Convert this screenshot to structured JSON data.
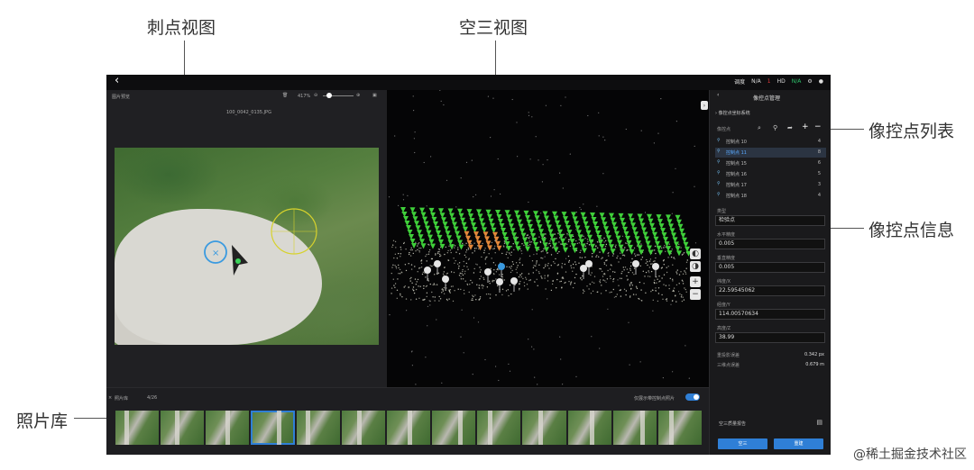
{
  "callouts": {
    "ci_dian": "刺点视图",
    "kong_san": "空三视图",
    "list": "像控点列表",
    "info": "像控点信息",
    "photo_lib": "照片库"
  },
  "topbar": {
    "back_icon": "chevron-left",
    "status": [
      "调度",
      "N/A",
      "1",
      "HD",
      "N/A"
    ]
  },
  "left_panel": {
    "title": "图片预览",
    "zoom": "417%",
    "filename": "100_0042_0135.JPG"
  },
  "right_panel": {
    "title": "像控点管理",
    "section": "像控点坐标系统",
    "list_header": "像控点",
    "points": [
      {
        "name": "控制点 10",
        "count": "4"
      },
      {
        "name": "控制点 11",
        "count": "8",
        "selected": true
      },
      {
        "name": "控制点 15",
        "count": "6"
      },
      {
        "name": "控制点 16",
        "count": "5"
      },
      {
        "name": "控制点 17",
        "count": "3"
      },
      {
        "name": "控制点 18",
        "count": "4"
      }
    ],
    "type_label": "类型",
    "type_value": "检验点",
    "h_acc_label": "水平精度",
    "h_acc": "0.005",
    "v_acc_label": "垂直精度",
    "v_acc": "0.005",
    "lat_label": "纬度/X",
    "lat": "22.59545062",
    "lon_label": "经度/Y",
    "lon": "114.00570634",
    "alt_label": "高度/Z",
    "alt": "38.99",
    "reproj_label": "重投影误差",
    "reproj": "0.342 px",
    "err3d_label": "三维点误差",
    "err3d": "0.679 m",
    "report": "空三质量报告",
    "btn_left": "空三",
    "btn_right": "重建"
  },
  "strip": {
    "label": "照片库",
    "count": "4/26",
    "toggle_label": "仅展示带控制点照片"
  },
  "watermark": "@稀土掘金技术社区"
}
